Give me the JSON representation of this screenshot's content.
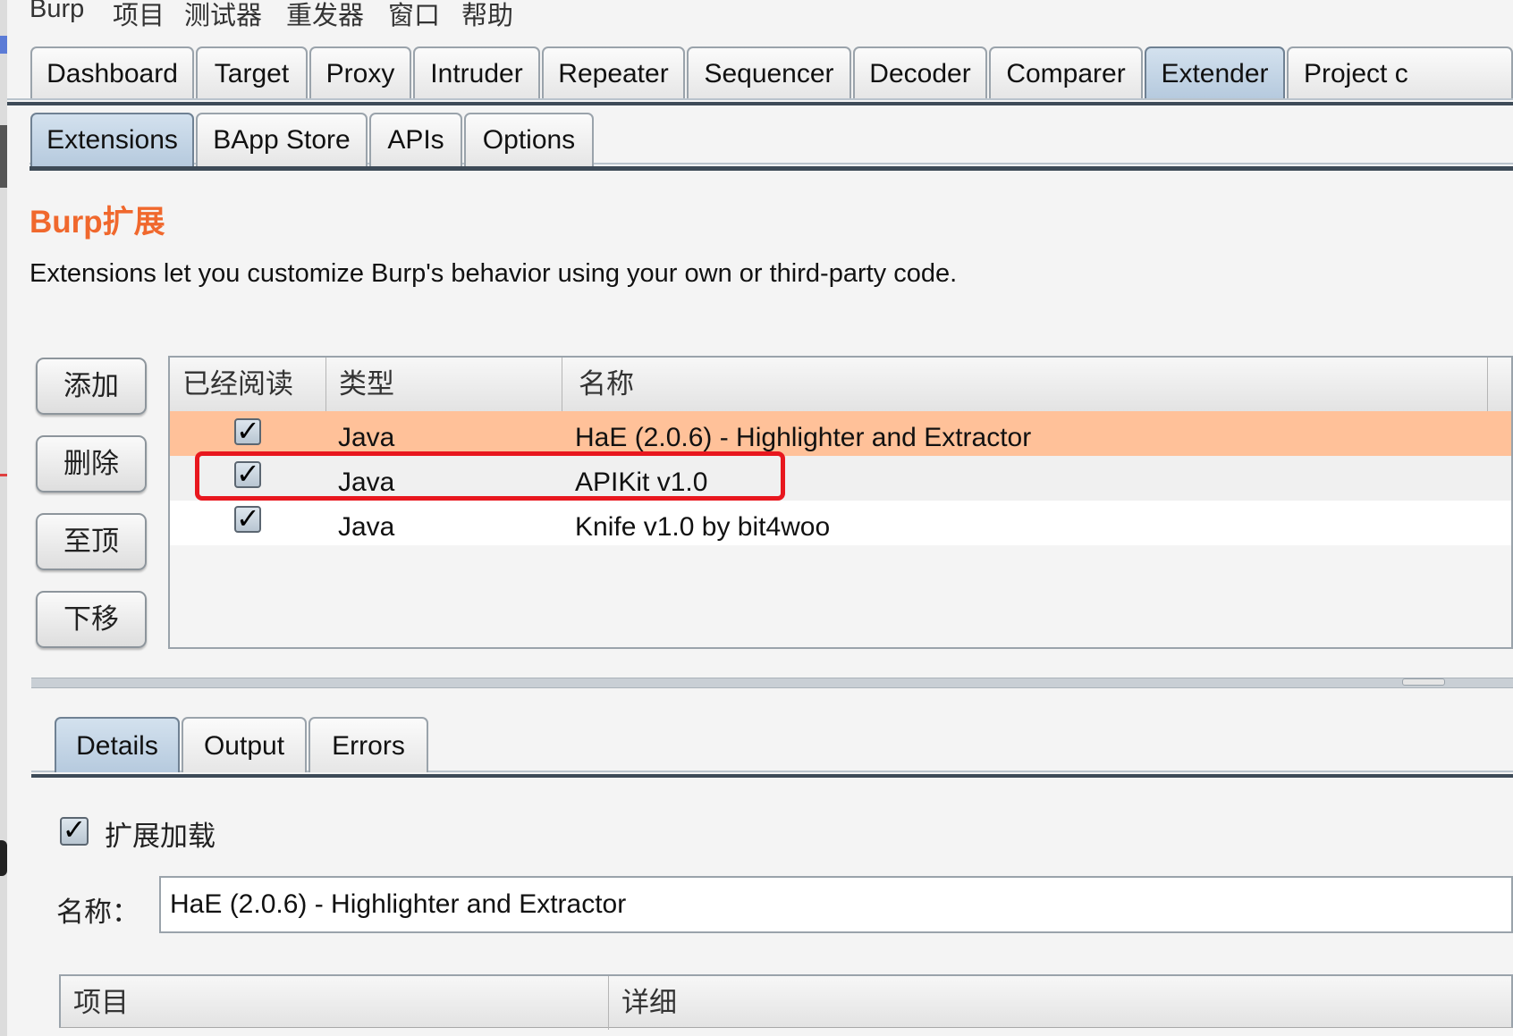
{
  "menu": [
    "Burp",
    "项目",
    "测试器",
    "重发器",
    "窗口",
    "帮助"
  ],
  "top_tabs": [
    "Dashboard",
    "Target",
    "Proxy",
    "Intruder",
    "Repeater",
    "Sequencer",
    "Decoder",
    "Comparer",
    "Extender",
    "Project c"
  ],
  "top_tabs_active": "Extender",
  "sub_tabs": [
    "Extensions",
    "BApp Store",
    "APIs",
    "Options"
  ],
  "sub_tabs_active": "Extensions",
  "page": {
    "title": "Burp扩展",
    "description": "Extensions let you customize Burp's behavior using your own or third-party code."
  },
  "side_buttons": [
    "添加",
    "删除",
    "至顶",
    "下移"
  ],
  "extensions_table": {
    "columns": [
      "已经阅读",
      "类型",
      "名称"
    ],
    "rows": [
      {
        "loaded": true,
        "type": "Java",
        "name": "HaE (2.0.6) - Highlighter and Extractor",
        "selected": true
      },
      {
        "loaded": true,
        "type": "Java",
        "name": "APIKit v1.0",
        "selected": false
      },
      {
        "loaded": true,
        "type": "Java",
        "name": "Knife v1.0 by bit4woo",
        "selected": false
      }
    ]
  },
  "detail_tabs": [
    "Details",
    "Output",
    "Errors"
  ],
  "detail_tabs_active": "Details",
  "details": {
    "loaded_label": "扩展加载",
    "loaded": true,
    "name_label": "名称：",
    "name_value": "HaE (2.0.6) - Highlighter and Extractor",
    "table_columns": [
      "项目",
      "详细"
    ]
  },
  "colors": {
    "accent_title": "#f0682d",
    "selected_row": "#ffc199",
    "highlight_box": "#e8171e",
    "active_tab": "#c5d6e7"
  },
  "check_glyph": "✓"
}
